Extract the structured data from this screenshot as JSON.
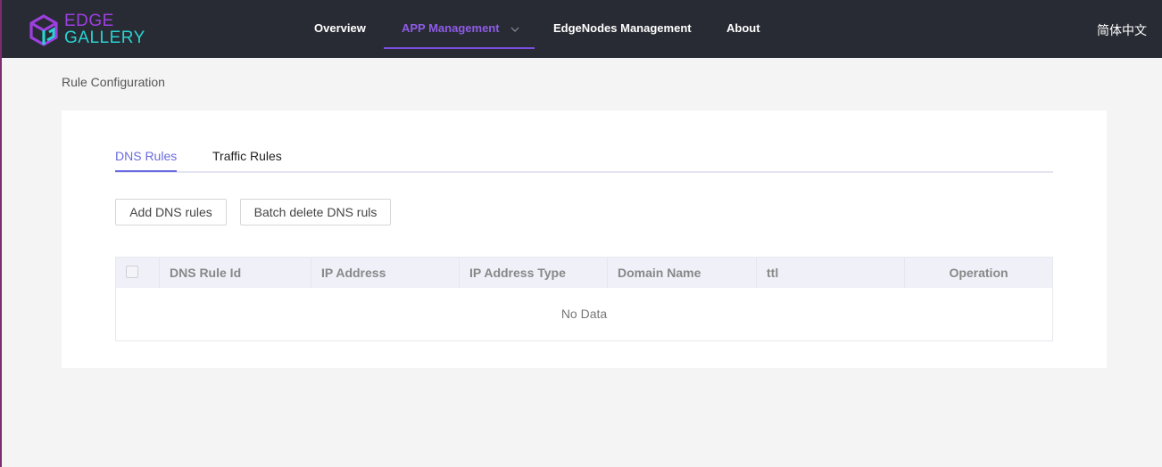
{
  "header": {
    "logo": {
      "line1": "EDGE",
      "line2": "GALLERY"
    },
    "nav": [
      {
        "label": "Overview"
      },
      {
        "label": "APP Management"
      },
      {
        "label": "EdgeNodes Management"
      },
      {
        "label": "About"
      }
    ],
    "language": "简体中文",
    "colors": {
      "bar": "#282b33",
      "active": "#8e5be6",
      "logo_purple": "#9d3fe0",
      "logo_cyan": "#29d3d1"
    }
  },
  "breadcrumb": "Rule Configuration",
  "tabs": [
    {
      "label": "DNS Rules",
      "active": true
    },
    {
      "label": "Traffic Rules",
      "active": false
    }
  ],
  "toolbar": {
    "add_label": "Add DNS rules",
    "batch_delete_label": "Batch delete DNS ruls"
  },
  "table": {
    "columns": [
      "DNS Rule Id",
      "IP Address",
      "IP Address Type",
      "Domain Name",
      "ttl",
      "Operation"
    ],
    "rows": [],
    "empty_text": "No Data"
  }
}
